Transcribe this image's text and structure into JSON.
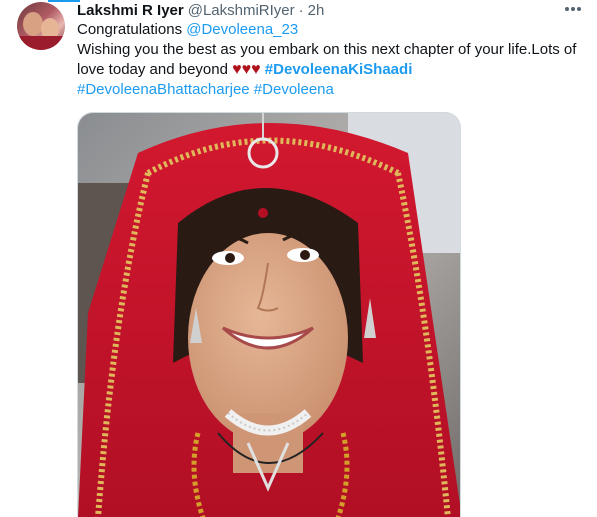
{
  "tweet": {
    "author_name": "Lakshmi R Iyer",
    "author_handle": "@LakshmiRIyer",
    "separator": "·",
    "timestamp": "2h",
    "line1_prefix": "Congratulations ",
    "mention": "@Devoleena_23",
    "line2": "Wishing you the best as you embark on this next chapter of your life.Lots of love today and beyond ",
    "hearts": "♥♥♥",
    "hashtag_1": "#DevoleenaKiShaadi",
    "hashtag_2": "#DevoleenaBhattacharjee",
    "hashtag_3": "#Devoleena"
  },
  "icons": {
    "more": "more-horizontal-icon",
    "avatar": "avatar"
  },
  "colors": {
    "link": "#1d9bf0",
    "text": "#0f1419",
    "secondary": "#536471",
    "heart": "#b0121c",
    "saree_red": "#c4122a"
  }
}
